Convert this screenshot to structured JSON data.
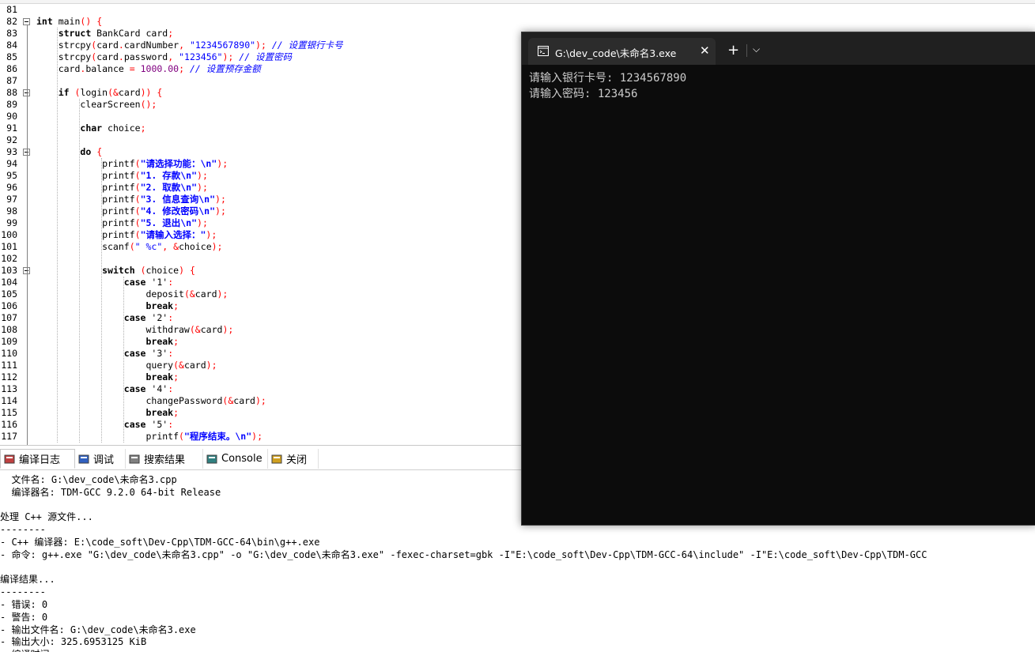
{
  "editor": {
    "lines": [
      {
        "n": "81",
        "html": ""
      },
      {
        "n": "82",
        "html": "<span class='kw'>int</span> main<span class='op'>()</span> <span class='op'>{</span>"
      },
      {
        "n": "83",
        "html": "    <span class='kw'>struct</span> BankCard card<span class='op'>;</span>"
      },
      {
        "n": "84",
        "html": "    strcpy<span class='op'>(</span>card<span class='op'>.</span>cardNumber<span class='op'>,</span> <span class='str'>\"1234567890\"</span><span class='op'>);</span> <span class='cmt'>// 设置银行卡号</span>"
      },
      {
        "n": "85",
        "html": "    strcpy<span class='op'>(</span>card<span class='op'>.</span>password<span class='op'>,</span> <span class='str'>\"123456\"</span><span class='op'>);</span> <span class='cmt'>// 设置密码</span>"
      },
      {
        "n": "86",
        "html": "    card<span class='op'>.</span>balance <span class='op'>=</span> <span class='num'>1000.00</span><span class='op'>;</span> <span class='cmt'>// 设置预存金额</span>"
      },
      {
        "n": "87",
        "html": ""
      },
      {
        "n": "88",
        "html": "    <span class='kw'>if</span> <span class='op'>(</span>login<span class='op'>(&amp;</span>card<span class='op'>))</span> <span class='op'>{</span>"
      },
      {
        "n": "89",
        "html": "        clearScreen<span class='op'>();</span>"
      },
      {
        "n": "90",
        "html": ""
      },
      {
        "n": "91",
        "html": "        <span class='kw'>char</span> choice<span class='op'>;</span>"
      },
      {
        "n": "92",
        "html": ""
      },
      {
        "n": "93",
        "html": "        <span class='kw'>do</span> <span class='op'>{</span>"
      },
      {
        "n": "94",
        "html": "            printf<span class='op'>(</span><span class='strcn'>\"请选择功能：\\n\"</span><span class='op'>);</span>"
      },
      {
        "n": "95",
        "html": "            printf<span class='op'>(</span><span class='strcn'>\"1. 存款\\n\"</span><span class='op'>);</span>"
      },
      {
        "n": "96",
        "html": "            printf<span class='op'>(</span><span class='strcn'>\"2. 取款\\n\"</span><span class='op'>);</span>"
      },
      {
        "n": "97",
        "html": "            printf<span class='op'>(</span><span class='strcn'>\"3. 信息查询\\n\"</span><span class='op'>);</span>"
      },
      {
        "n": "98",
        "html": "            printf<span class='op'>(</span><span class='strcn'>\"4. 修改密码\\n\"</span><span class='op'>);</span>"
      },
      {
        "n": "99",
        "html": "            printf<span class='op'>(</span><span class='strcn'>\"5. 退出\\n\"</span><span class='op'>);</span>"
      },
      {
        "n": "100",
        "html": "            printf<span class='op'>(</span><span class='strcn'>\"请输入选择：\"</span><span class='op'>);</span>"
      },
      {
        "n": "101",
        "html": "            scanf<span class='op'>(</span><span class='str'>\" %c\"</span><span class='op'>,</span> <span class='op'>&amp;</span>choice<span class='op'>);</span>"
      },
      {
        "n": "102",
        "html": ""
      },
      {
        "n": "103",
        "html": "            <span class='kw'>switch</span> <span class='op'>(</span>choice<span class='op'>)</span> <span class='op'>{</span>"
      },
      {
        "n": "104",
        "html": "                <span class='kw'>case</span> <span class='chr'>'1'</span><span class='op'>:</span>"
      },
      {
        "n": "105",
        "html": "                    deposit<span class='op'>(&amp;</span>card<span class='op'>);</span>"
      },
      {
        "n": "106",
        "html": "                    <span class='kw'>break</span><span class='op'>;</span>"
      },
      {
        "n": "107",
        "html": "                <span class='kw'>case</span> <span class='chr'>'2'</span><span class='op'>:</span>"
      },
      {
        "n": "108",
        "html": "                    withdraw<span class='op'>(&amp;</span>card<span class='op'>);</span>"
      },
      {
        "n": "109",
        "html": "                    <span class='kw'>break</span><span class='op'>;</span>"
      },
      {
        "n": "110",
        "html": "                <span class='kw'>case</span> <span class='chr'>'3'</span><span class='op'>:</span>"
      },
      {
        "n": "111",
        "html": "                    query<span class='op'>(&amp;</span>card<span class='op'>);</span>"
      },
      {
        "n": "112",
        "html": "                    <span class='kw'>break</span><span class='op'>;</span>"
      },
      {
        "n": "113",
        "html": "                <span class='kw'>case</span> <span class='chr'>'4'</span><span class='op'>:</span>"
      },
      {
        "n": "114",
        "html": "                    changePassword<span class='op'>(&amp;</span>card<span class='op'>);</span>"
      },
      {
        "n": "115",
        "html": "                    <span class='kw'>break</span><span class='op'>;</span>"
      },
      {
        "n": "116",
        "html": "                <span class='kw'>case</span> <span class='chr'>'5'</span><span class='op'>:</span>"
      },
      {
        "n": "117",
        "html": "                    printf<span class='op'>(</span><span class='strcn'>\"程序结束。\\n\"</span><span class='op'>);</span>"
      }
    ]
  },
  "tabs": [
    {
      "label": "编译日志",
      "icon": "compile-log-icon",
      "color": "#c04040"
    },
    {
      "label": "调试",
      "icon": "debug-icon",
      "color": "#3060c0"
    },
    {
      "label": "搜索结果",
      "icon": "search-results-icon",
      "color": "#808080"
    },
    {
      "label": "Console",
      "icon": "console-icon",
      "color": "#308080"
    },
    {
      "label": "关闭",
      "icon": "close-panel-icon",
      "color": "#d0a020"
    }
  ],
  "log": [
    "  文件名: G:\\dev_code\\未命名3.cpp",
    "  编译器名: TDM-GCC 9.2.0 64-bit Release",
    "",
    "处理 C++ 源文件...",
    "--------",
    "- C++ 编译器: E:\\code_soft\\Dev-Cpp\\TDM-GCC-64\\bin\\g++.exe",
    "- 命令: g++.exe \"G:\\dev_code\\未命名3.cpp\" -o \"G:\\dev_code\\未命名3.exe\" -fexec-charset=gbk -I\"E:\\code_soft\\Dev-Cpp\\TDM-GCC-64\\include\" -I\"E:\\code_soft\\Dev-Cpp\\TDM-GCC",
    "",
    "编译结果...",
    "--------",
    "- 错误: 0",
    "- 警告: 0",
    "- 输出文件名: G:\\dev_code\\未命名3.exe",
    "- 输出大小: 325.6953125 KiB",
    "- 编译时间: "
  ],
  "terminal": {
    "tab_title": "G:\\dev_code\\未命名3.exe",
    "close_glyph": "✕",
    "new_tab_glyph": "+",
    "dropdown_glyph": "⌵",
    "lines": [
      "请输入银行卡号: 1234567890",
      "请输入密码: 123456"
    ]
  }
}
